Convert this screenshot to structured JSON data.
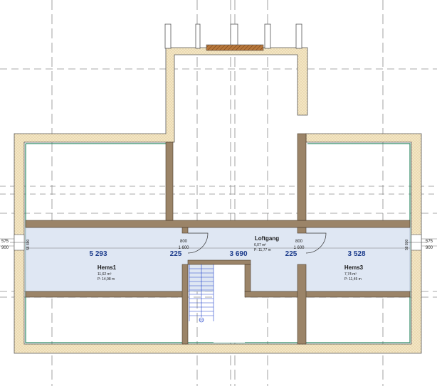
{
  "rooms": [
    {
      "name": "Hems1",
      "area": "11,62 m²",
      "perimeter": "P: 14,98 m"
    },
    {
      "name": "Loftgang",
      "area": "6,07 m²",
      "perimeter": "P: 11,77 m"
    },
    {
      "name": "Hems3",
      "area": "7,74 m²",
      "perimeter": "P: 11,45 m"
    }
  ],
  "dimensions": {
    "segments": [
      "5 293",
      "225",
      "3 690",
      "225",
      "3 528"
    ],
    "door_left": {
      "top": "800",
      "bottom": "1 600"
    },
    "door_right": {
      "top": "800",
      "bottom": "1 600"
    },
    "left_side": {
      "a": "575",
      "b": "900",
      "vert": "58 800"
    },
    "right_side": {
      "a": "575",
      "b": "900",
      "vert": "58 800"
    }
  },
  "colors": {
    "insulation": "#f3e6c4",
    "wall": "#9b8468",
    "corridor": "#dfe7f3",
    "finish_line": "#2e8a63",
    "beam": "#9a5a2a",
    "stair": "#2244cc"
  }
}
